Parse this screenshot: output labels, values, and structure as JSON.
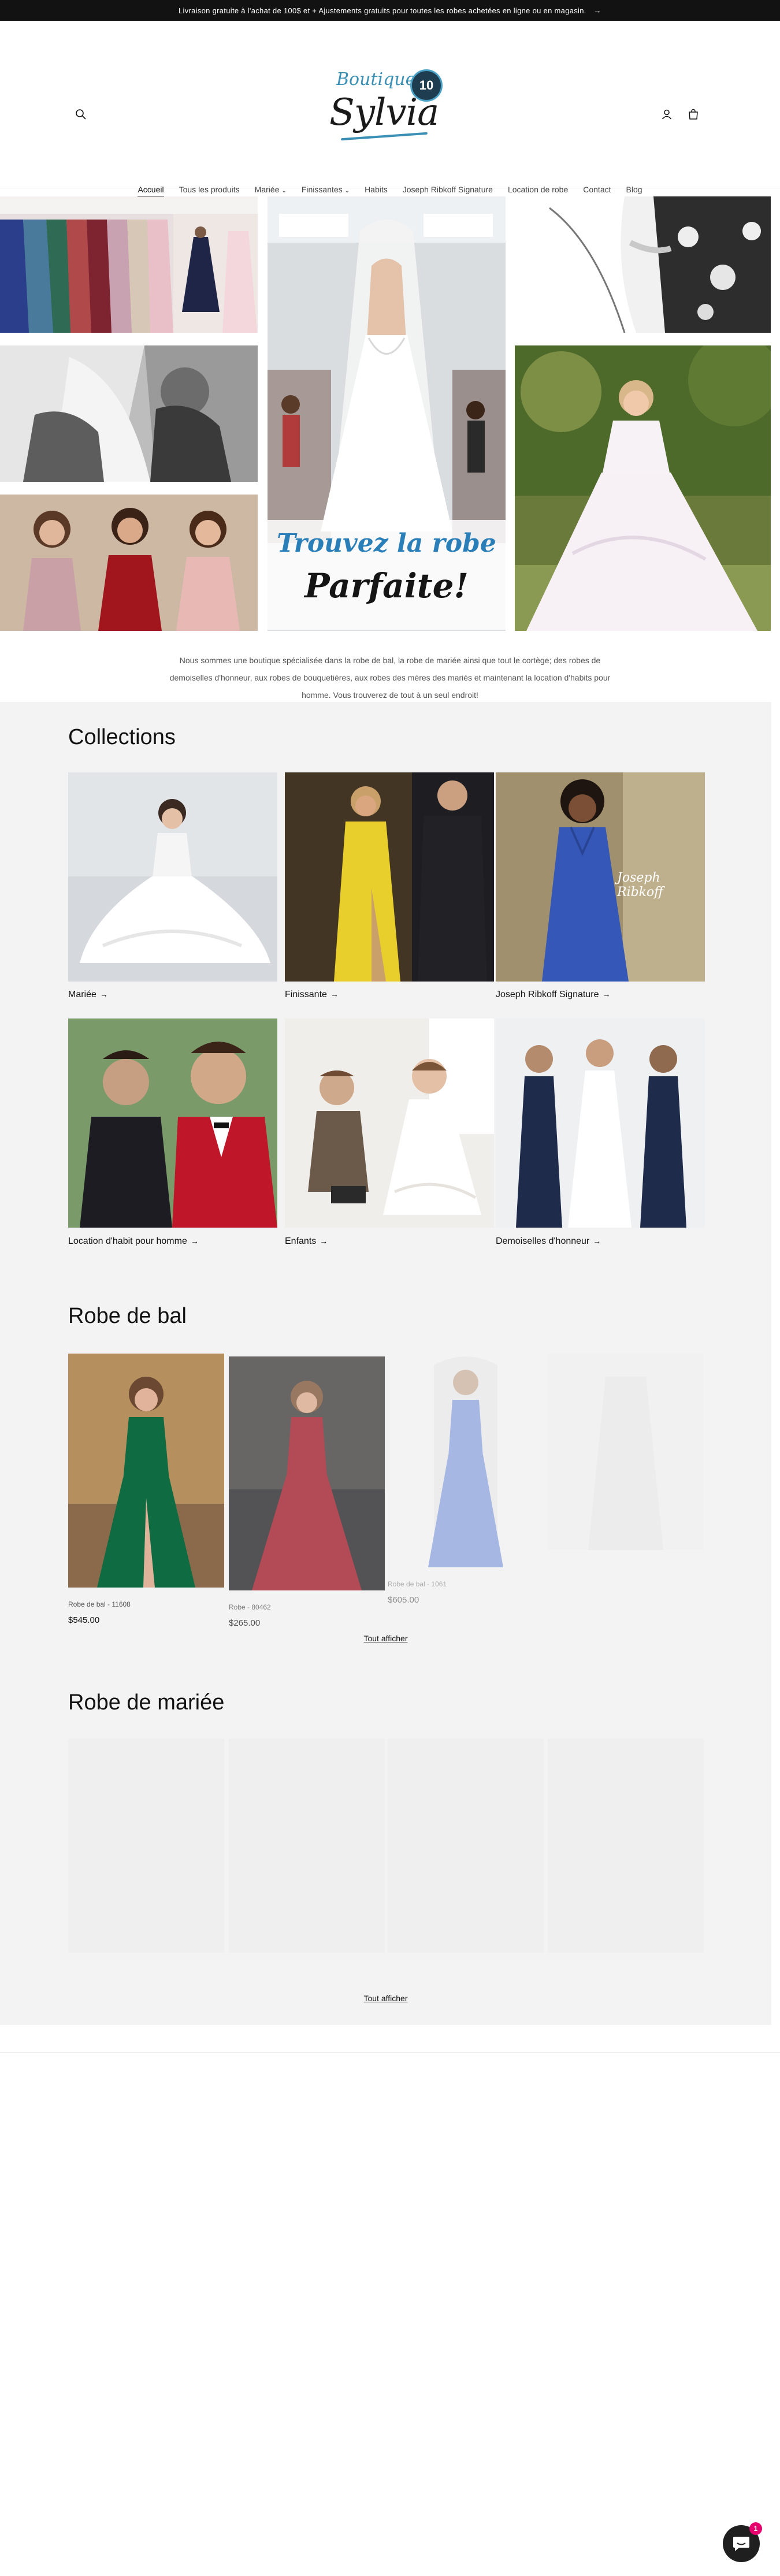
{
  "announcement": {
    "text": "Livraison gratuite à l'achat de 100$ et + Ajustements gratuits pour toutes les robes achetées en ligne ou en magasin.",
    "arrow": "→"
  },
  "header": {
    "logo_top": "Boutique",
    "logo_main": "Sylvia",
    "logo_badge": "10",
    "icons": [
      "search-icon",
      "account-icon",
      "cart-icon"
    ]
  },
  "nav": {
    "items": [
      {
        "label": "Accueil",
        "active": true,
        "caret": ""
      },
      {
        "label": "Tous les produits",
        "caret": ""
      },
      {
        "label": "Mariée",
        "caret": "⌄"
      },
      {
        "label": "Finissantes",
        "caret": "⌄"
      },
      {
        "label": "Habits",
        "caret": ""
      },
      {
        "label": "Joseph Ribkoff Signature",
        "caret": ""
      },
      {
        "label": "Location de robe",
        "caret": ""
      },
      {
        "label": "Contact",
        "caret": ""
      },
      {
        "label": "Blog",
        "caret": ""
      }
    ]
  },
  "hero": {
    "overlay_line1": "Trouvez la robe",
    "overlay_line2": "Parfaite!"
  },
  "intro": {
    "text": "Nous sommes une boutique spécialisée dans la robe de bal, la robe de mariée ainsi que tout le cortège; des robes de demoiselles d'honneur, aux robes de bouquetières, aux robes des mères des mariés et maintenant la location d'habits pour homme. Vous trouverez de tout à un seul endroit!"
  },
  "collections": {
    "title": "Collections",
    "items": [
      {
        "label": "Mariée",
        "arrow": "→"
      },
      {
        "label": "Finissante",
        "arrow": "→"
      },
      {
        "label": "Joseph Ribkoff Signature",
        "arrow": "→"
      },
      {
        "label": "Location d'habit pour homme",
        "arrow": "→"
      },
      {
        "label": "Enfants",
        "arrow": "→"
      },
      {
        "label": "Demoiselles d'honneur",
        "arrow": "→"
      }
    ],
    "watermark": "Joseph Ribkoff"
  },
  "prom": {
    "title": "Robe de bal",
    "products": [
      {
        "name": "Robe de bal - 11608",
        "price": "$545.00"
      },
      {
        "name": "Robe - 80462",
        "price": "$265.00"
      },
      {
        "name": "Robe de bal - 1061",
        "price": "$605.00"
      }
    ],
    "view_all": "Tout afficher"
  },
  "bridal": {
    "title": "Robe de mariée",
    "view_all": "Tout afficher"
  },
  "chat": {
    "badge": "1",
    "icon": "chat-icon"
  }
}
